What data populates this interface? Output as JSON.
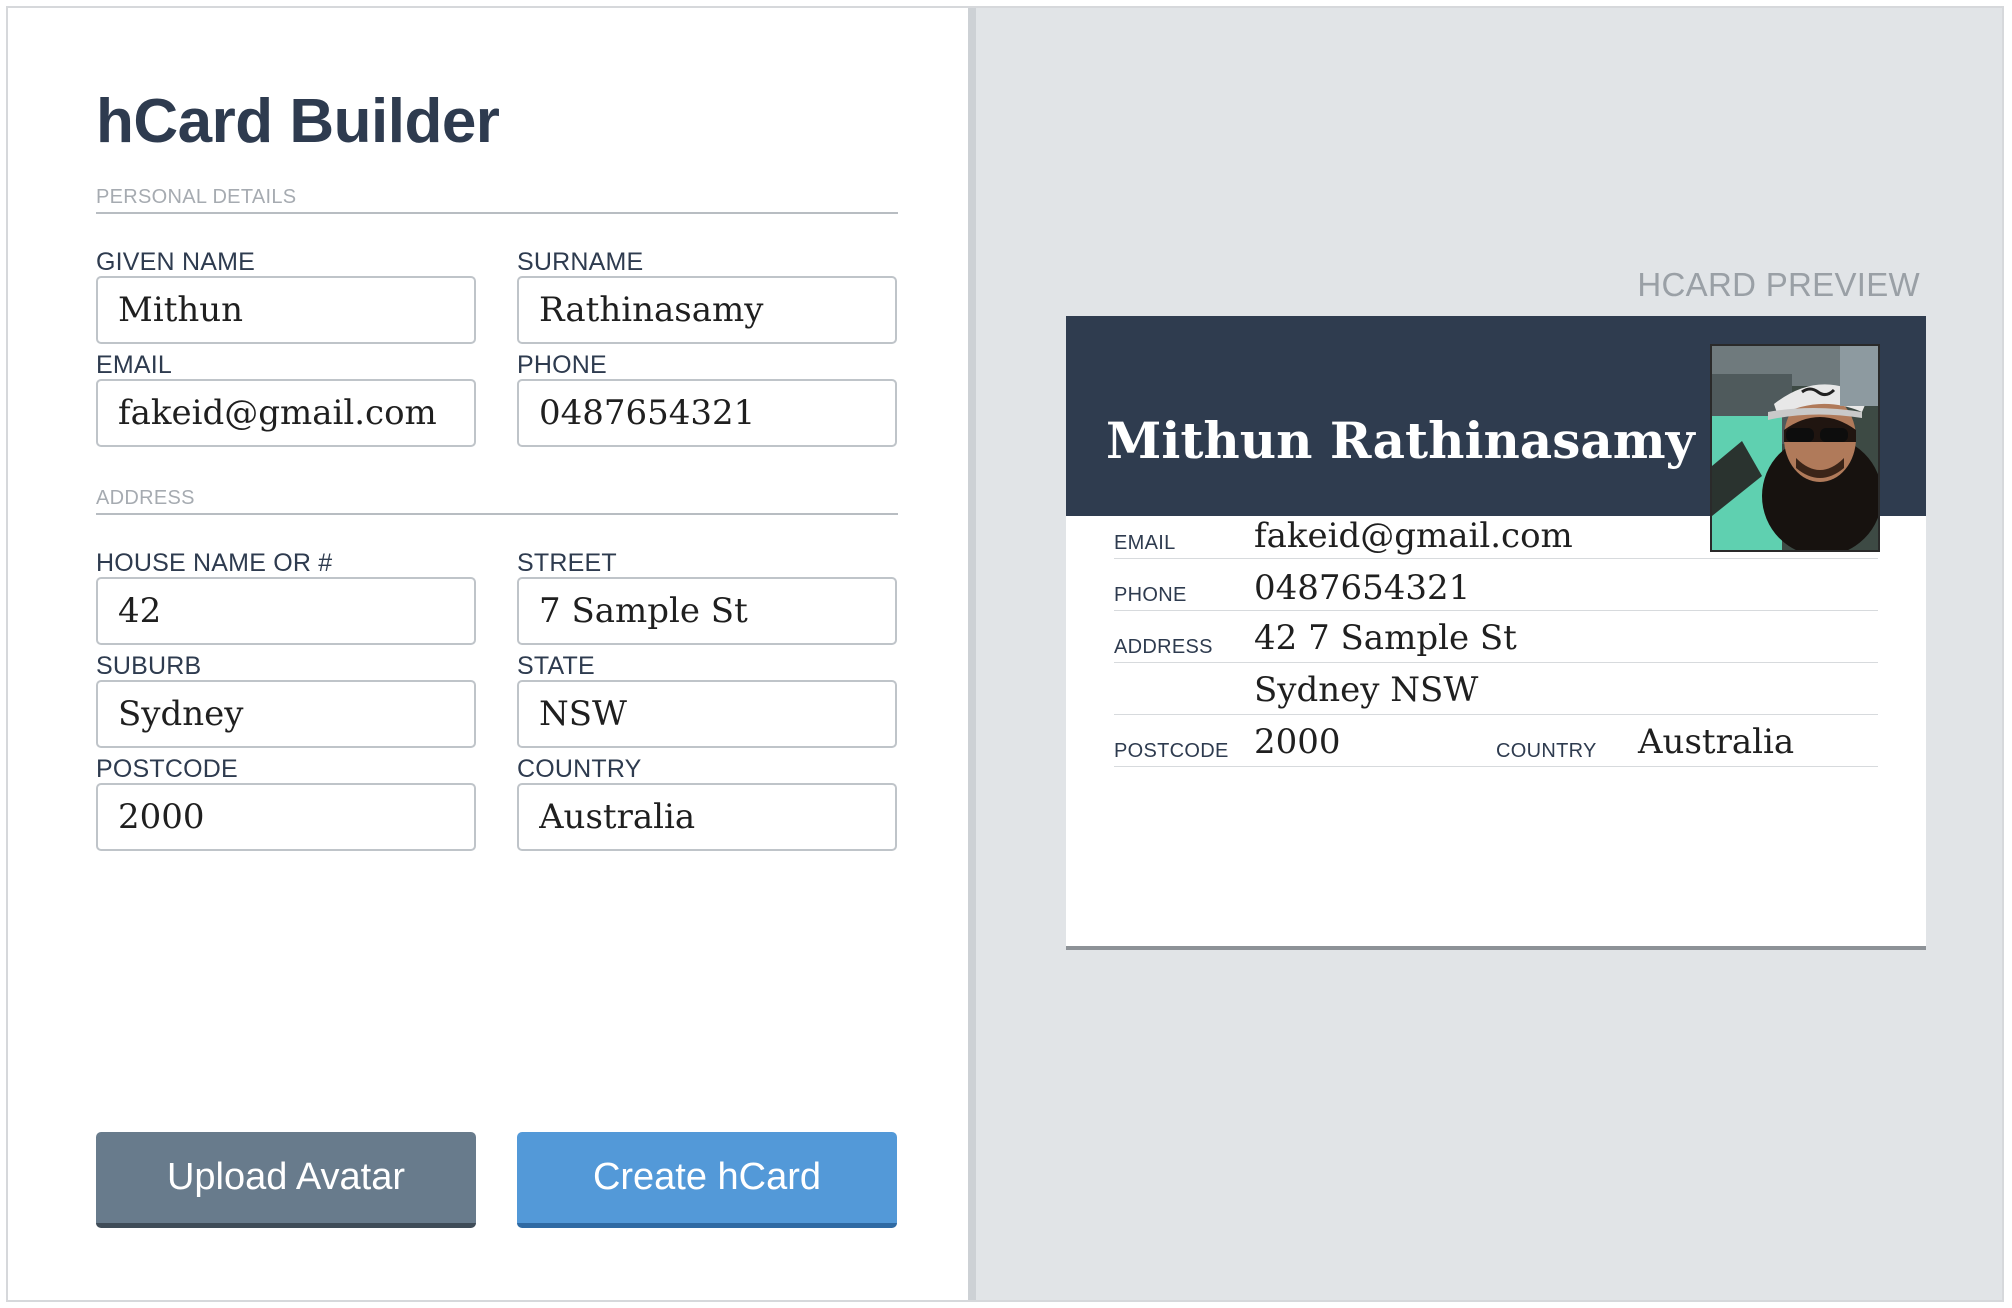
{
  "app": {
    "title": "hCard Builder"
  },
  "form": {
    "personal_section": "PERSONAL DETAILS",
    "address_section": "ADDRESS",
    "fields": {
      "given_name": {
        "label": "GIVEN NAME",
        "value": "Mithun"
      },
      "surname": {
        "label": "SURNAME",
        "value": "Rathinasamy"
      },
      "email": {
        "label": "EMAIL",
        "value": "fakeid@gmail.com"
      },
      "phone": {
        "label": "PHONE",
        "value": "0487654321"
      },
      "house": {
        "label": "HOUSE NAME OR #",
        "value": "42"
      },
      "street": {
        "label": "STREET",
        "value": "7 Sample St"
      },
      "suburb": {
        "label": "SUBURB",
        "value": "Sydney"
      },
      "state": {
        "label": "STATE",
        "value": "NSW"
      },
      "postcode": {
        "label": "POSTCODE",
        "value": "2000"
      },
      "country": {
        "label": "COUNTRY",
        "value": "Australia"
      }
    },
    "buttons": {
      "upload": "Upload Avatar",
      "create": "Create hCard"
    }
  },
  "preview": {
    "label": "HCARD PREVIEW",
    "name": "Mithun Rathinasamy",
    "rows": {
      "email": {
        "label": "EMAIL",
        "value": "fakeid@gmail.com"
      },
      "phone": {
        "label": "PHONE",
        "value": "0487654321"
      },
      "address": {
        "label": "ADDRESS",
        "line1": "42 7 Sample St",
        "line2": "Sydney NSW"
      },
      "postcode": {
        "label": "POSTCODE",
        "value": "2000"
      },
      "country": {
        "label": "COUNTRY",
        "value": "Australia"
      }
    }
  },
  "colors": {
    "title": "#2e3b4f",
    "card_header": "#2f3c4f",
    "upload_button": "#687b8c",
    "create_button": "#5399d8",
    "preview_background": "#e1e4e7"
  }
}
